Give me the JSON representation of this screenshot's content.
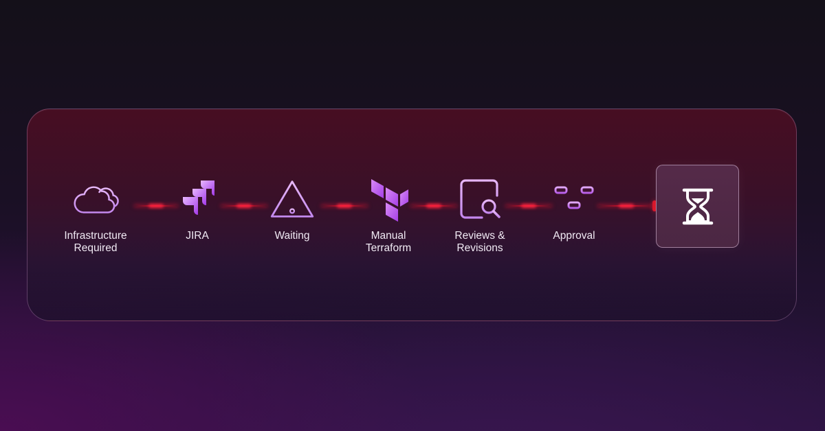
{
  "steps": [
    {
      "label": "Infrastructure\nRequired",
      "icon": "cloud-icon"
    },
    {
      "label": "JIRA",
      "icon": "jira-icon"
    },
    {
      "label": "Waiting",
      "icon": "warning-icon"
    },
    {
      "label": "Manual\nTerraform",
      "icon": "terraform-icon"
    },
    {
      "label": "Reviews &\nRevisions",
      "icon": "document-search-icon"
    },
    {
      "label": "Approval",
      "icon": "sliders-icon"
    }
  ],
  "final": {
    "icon": "hourglass-icon"
  },
  "colors": {
    "icon_stroke": "#d9a6f2",
    "icon_fill": "#b24df0",
    "connector": "#e0102a",
    "label_text": "#f1eaf4"
  }
}
